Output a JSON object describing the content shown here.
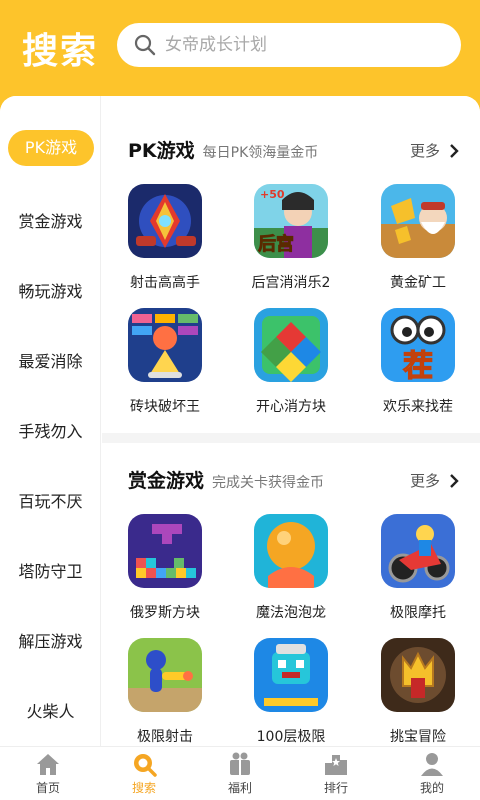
{
  "header": {
    "title": "搜索"
  },
  "search": {
    "placeholder": "女帝成长计划"
  },
  "sidebar": {
    "items": [
      {
        "label": "PK游戏",
        "active": true
      },
      {
        "label": "赏金游戏"
      },
      {
        "label": "畅玩游戏"
      },
      {
        "label": "最爱消除"
      },
      {
        "label": "手残勿入"
      },
      {
        "label": "百玩不厌"
      },
      {
        "label": "塔防守卫"
      },
      {
        "label": "解压游戏"
      },
      {
        "label": "火柴人"
      }
    ]
  },
  "sections": [
    {
      "title": "PK游戏",
      "subtitle": "每日PK领海量金币",
      "more": "更多",
      "games": [
        {
          "name": "射击高高手",
          "icon": "shooter-icon"
        },
        {
          "name": "后宫消消乐2",
          "icon": "palace-icon",
          "badge_text": "+50",
          "icon_text": "后宫"
        },
        {
          "name": "黄金矿工",
          "icon": "gold-miner-icon"
        },
        {
          "name": "砖块破坏王",
          "icon": "brick-breaker-icon"
        },
        {
          "name": "开心消方块",
          "icon": "block-match-icon"
        },
        {
          "name": "欢乐来找茬",
          "icon": "spot-difference-icon",
          "icon_text": "茬"
        }
      ]
    },
    {
      "title": "赏金游戏",
      "subtitle": "完成关卡获得金币",
      "more": "更多",
      "games": [
        {
          "name": "俄罗斯方块",
          "icon": "tetris-icon"
        },
        {
          "name": "魔法泡泡龙",
          "icon": "bubble-icon"
        },
        {
          "name": "极限摩托",
          "icon": "motorbike-icon"
        },
        {
          "name": "极限射击",
          "icon": "stickman-shooter-icon"
        },
        {
          "name": "100层极限",
          "icon": "hundred-floors-icon"
        },
        {
          "name": "挑宝冒险",
          "icon": "treasure-icon"
        }
      ]
    }
  ],
  "tabbar": [
    {
      "label": "首页",
      "icon": "home-icon"
    },
    {
      "label": "搜索",
      "icon": "search-icon",
      "active": true
    },
    {
      "label": "福利",
      "icon": "gift-icon"
    },
    {
      "label": "排行",
      "icon": "ranking-icon"
    },
    {
      "label": "我的",
      "icon": "profile-icon"
    }
  ],
  "colors": {
    "accent": "#FDC42B",
    "active_tab": "#F5A623"
  }
}
